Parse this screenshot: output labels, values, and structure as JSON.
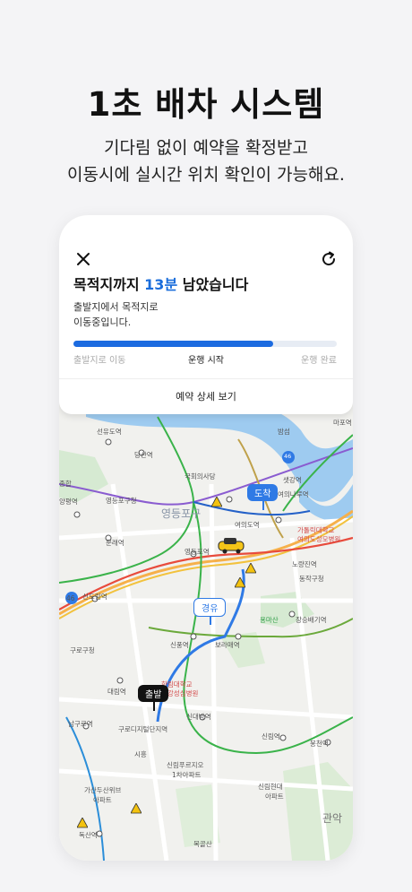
{
  "headline": "1초 배차 시스템",
  "subtitle": [
    "기다림 없이 예약을 확정받고",
    "이동시에 실시간 위치 확인이 가능해요."
  ],
  "card": {
    "title_prefix": "목적지까지 ",
    "title_highlight": "13분",
    "title_suffix": " 남았습니다",
    "description": [
      "출발지에서 목적지로",
      "이동중입니다."
    ],
    "progress": 0.76,
    "steps": [
      "출발지로 이동",
      "운행 시작",
      "운행 완료"
    ],
    "detail_button": "예약 상세 보기"
  },
  "map": {
    "labels": {
      "bamseom": "밤섬",
      "mapo": "마포역",
      "seonyudo": "선유도역",
      "dangsan": "당산역",
      "assembly": "국회의사당",
      "saetgang": "샛강역",
      "yeouinaru": "여의나루역",
      "yangpyeong": "양평역",
      "ydp_gucheong": "영등포구청",
      "yeongdeungpo_big": "영등포구",
      "yeouido": "여의도역",
      "catholic": "가톨릭대학교",
      "yeouido_stmary": "여의도성모병원",
      "mullae": "문래역",
      "ydp_station": "영등포역",
      "noryangjin": "노량진역",
      "dongjak": "동작구청",
      "sindorim": "신도림역",
      "yongmasan": "용마산",
      "jangseungbaegi": "장승배기역",
      "guro_gucheong": "구로구청",
      "sinpung": "신풍역",
      "boramae": "보라매역",
      "hallym": "한림대학교",
      "hallym2": "한강성심병원",
      "daerim": "대림역",
      "namguro": "남구로역",
      "gurodigital": "구로디지털단지역",
      "sindaebang": "신대방역",
      "sillim": "신림역",
      "bongcheon": "봉천역",
      "sinrim_pooreu": "신림푸르지오",
      "apt1": "1차아파트",
      "sillim_hyundai": "신림현대",
      "apt": "아파트",
      "gasan": "가산두산위브",
      "gasan_apt": "아파트",
      "doksan": "독산역",
      "mokgolsan": "목골산",
      "gwanak": "관악",
      "sihung": "시흥",
      "hwagok": "종합",
      "road46a": "46",
      "road46b": "46"
    },
    "pins": {
      "arrive": "도착",
      "via": "경유",
      "depart": "출발"
    }
  }
}
